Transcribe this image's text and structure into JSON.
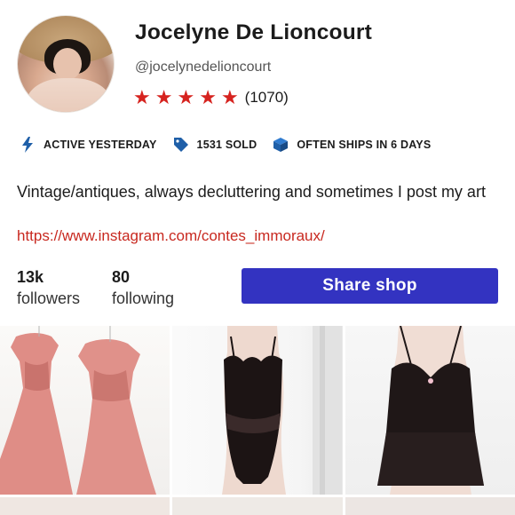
{
  "profile": {
    "name": "Jocelyne De Lioncourt",
    "handle": "@jocelynedelioncourt",
    "rating_stars": 5,
    "rating_count": "(1070)"
  },
  "badges": [
    {
      "icon": "lightning-icon",
      "label": "ACTIVE YESTERDAY"
    },
    {
      "icon": "tag-icon",
      "label": "1531 SOLD"
    },
    {
      "icon": "box-icon",
      "label": "OFTEN SHIPS IN 6 DAYS"
    }
  ],
  "bio": {
    "text": "Vintage/antiques, always decluttering and sometimes I post my art",
    "link": "https://www.instagram.com/contes_immoraux/"
  },
  "stats": {
    "followers": {
      "value": "13k",
      "label": "followers"
    },
    "following": {
      "value": "80",
      "label": "following"
    }
  },
  "actions": {
    "share_label": "Share shop"
  },
  "colors": {
    "accent_blue": "#3333c1",
    "star_red": "#d6231f",
    "link_red": "#c8281f",
    "icon_blue": "#1f5fa8"
  },
  "listings": [
    {
      "icon": "pink-dress-photo"
    },
    {
      "icon": "black-lace-bodysuit-photo"
    },
    {
      "icon": "black-lace-camisole-photo"
    }
  ]
}
